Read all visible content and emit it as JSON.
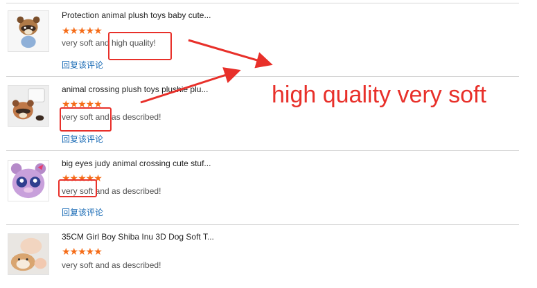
{
  "reviews": [
    {
      "title": "Protection animal plush toys baby cute...",
      "stars": "★★★★★",
      "comment": "very soft and high quality!",
      "reply": "回复该评论"
    },
    {
      "title": "animal crossing plush toys plushie plu...",
      "stars": "★★★★★",
      "comment": "very soft and as described!",
      "reply": "回复该评论"
    },
    {
      "title": "big eyes judy animal crossing cute stuf...",
      "stars": "★★★★★",
      "comment": "very soft and as described!",
      "reply": "回复该评论"
    },
    {
      "title": "35CM Girl Boy Shiba Inu 3D Dog Soft T...",
      "stars": "★★★★★",
      "comment": "very soft and as described!"
    }
  ],
  "overlay": {
    "text": "high quality very soft"
  },
  "colors": {
    "annotation": "#e8302a",
    "star": "#f56c18",
    "link": "#1a6bb5"
  },
  "icons": [
    "raccoon-plush-thumbnail",
    "raccoon-face-plush-thumbnail",
    "purple-bear-plush-thumbnail",
    "shiba-inu-plush-thumbnail"
  ]
}
